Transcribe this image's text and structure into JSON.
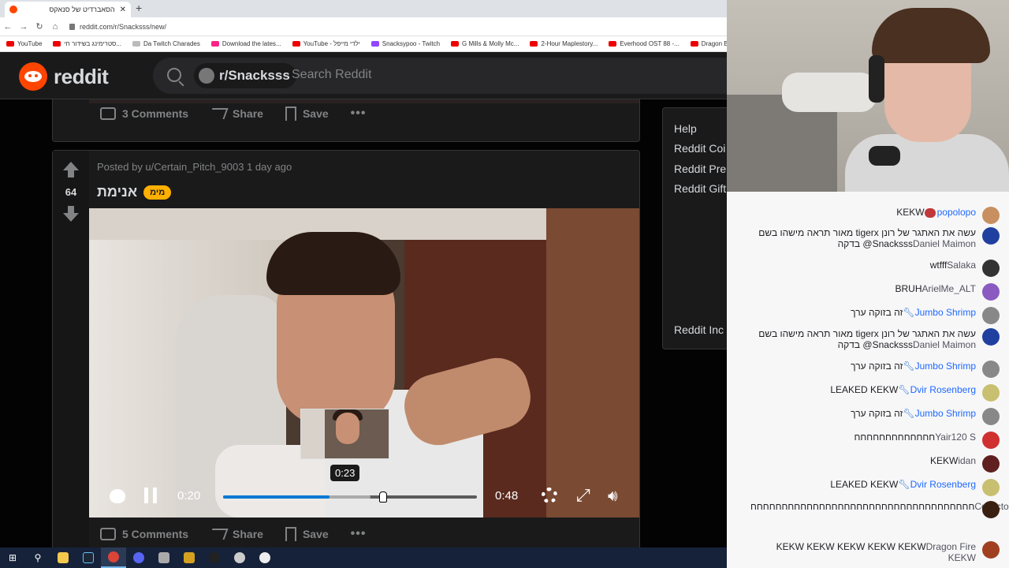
{
  "browser": {
    "tab_title": "הסאברדיט של סנאקס",
    "url": "reddit.com/r/Snacksss/new/",
    "bookmarks": [
      "YouTube",
      "סטרימינג בשידור חי...",
      "Da Twitch Charades",
      "Download the lates...",
      "YouTube - ילדי מייפל",
      "Snacksypoo - Twitch",
      "G Mills & Molly Mc...",
      "2-Hour Maplestory...",
      "Everhood OST 88 -...",
      "Dragon Ball Z"
    ]
  },
  "header": {
    "logo_text": "reddit",
    "subreddit": "r/Snacksss",
    "search_placeholder": "Search Reddit"
  },
  "prev_post": {
    "comments": "3 Comments",
    "share": "Share",
    "save": "Save",
    "more": "•••"
  },
  "post": {
    "score": "64",
    "meta": "Posted by u/Certain_Pitch_9003 1 day ago",
    "title": "אנימת",
    "flair": "מימ",
    "video": {
      "current_time": "0:20",
      "duration": "0:48",
      "hover_time": "0:23",
      "played_fraction": 0.42,
      "buffered_fraction": 0.58
    },
    "comments": "5 Comments",
    "share": "Share",
    "save": "Save",
    "more": "•••"
  },
  "sidebar": {
    "items": [
      "Help",
      "Reddit Coi",
      "Reddit Pre",
      "Reddit Gift",
      "Reddit Inc"
    ]
  },
  "chat": {
    "messages": [
      {
        "user": "popolopo",
        "text": "KEKW",
        "color": "blue",
        "avatar": "#c89060",
        "emote": true
      },
      {
        "user": "Daniel Maimon",
        "text": "מאור תראה מישהו בשם tigerx עשה את האתגר של רונן בדקה @Snacksss",
        "color": "gray",
        "avatar": "#2040a0"
      },
      {
        "user": "Salaka",
        "text": "wtfff",
        "color": "gray",
        "avatar": "#333"
      },
      {
        "user": "ArielMe_ALT",
        "text": "BRUH",
        "color": "gray",
        "avatar": "#8a5ac0"
      },
      {
        "user": "Jumbo Shrimp",
        "text": "זה בזוקה ערך",
        "color": "blue",
        "avatar": "#888",
        "wrench": true
      },
      {
        "user": "Daniel Maimon",
        "text": "מאור תראה מישהו בשם tigerx עשה את האתגר של רונן בדקה @Snacksss",
        "color": "gray",
        "avatar": "#2040a0"
      },
      {
        "user": "Jumbo Shrimp",
        "text": "זה בזוקה ערך",
        "color": "blue",
        "avatar": "#888",
        "wrench": true
      },
      {
        "user": "Dvir Rosenberg",
        "text": "LEAKED KEKW",
        "color": "blue",
        "avatar": "#c8c070",
        "wrench": true
      },
      {
        "user": "Jumbo Shrimp",
        "text": "זה בזוקה ערך",
        "color": "blue",
        "avatar": "#888",
        "wrench": true
      },
      {
        "user": "Yair120 S",
        "text": "חחחחחחחחחחחחח",
        "color": "gray",
        "avatar": "#d03030"
      },
      {
        "user": "idan",
        "text": "KEKW",
        "color": "gray",
        "avatar": "#602020"
      },
      {
        "user": "Dvir Rosenberg",
        "text": "LEAKED KEKW",
        "color": "blue",
        "avatar": "#c8c070",
        "wrench": true
      },
      {
        "user": "Collectorius",
        "text": "חחחחחחחחחחחחחחחחחחחחחחחחחחחחחחחחחחחח",
        "color": "gray",
        "avatar": "#3a2010"
      },
      {
        "user": "Dragon Fire KEKW",
        "text": "KEKW KEKW KEKW KEKW KEKW",
        "color": "gray",
        "avatar": "#a04020"
      }
    ]
  },
  "colors": {
    "reddit_orange": "#ff4500",
    "reddit_bg": "#1a1a1b",
    "progress_blue": "#0079d3",
    "flair": "#ffb000",
    "chat_blue": "#1e69ff"
  }
}
